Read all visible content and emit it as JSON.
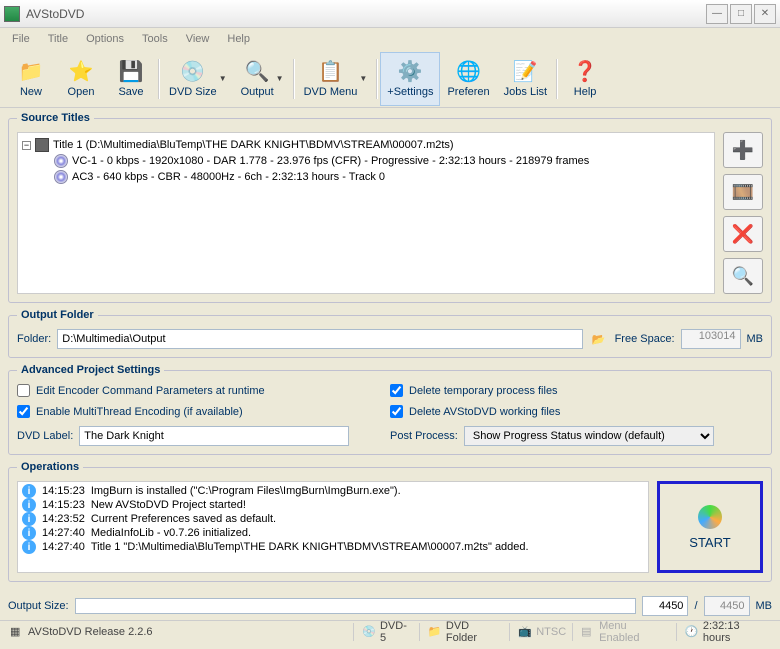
{
  "window": {
    "title": "AVStoDVD"
  },
  "menu": [
    "File",
    "Title",
    "Options",
    "Tools",
    "View",
    "Help"
  ],
  "toolbar": [
    {
      "id": "new",
      "label": "New",
      "icon": "📁"
    },
    {
      "id": "open",
      "label": "Open",
      "icon": "⭐"
    },
    {
      "id": "save",
      "label": "Save",
      "icon": "💾"
    },
    {
      "id": "dvdsize",
      "label": "DVD Size",
      "icon": "💿",
      "dd": true
    },
    {
      "id": "output",
      "label": "Output",
      "icon": "🔍",
      "dd": true
    },
    {
      "id": "dvdmenu",
      "label": "DVD Menu",
      "icon": "📋",
      "dd": true
    },
    {
      "id": "settings",
      "label": "+Settings",
      "icon": "⚙️",
      "sel": true
    },
    {
      "id": "preferen",
      "label": "Preferen",
      "icon": "🌐"
    },
    {
      "id": "jobslist",
      "label": "Jobs List",
      "icon": "📝"
    },
    {
      "id": "help",
      "label": "Help",
      "icon": "❓"
    }
  ],
  "groups": {
    "source": "Source Titles",
    "output": "Output Folder",
    "advanced": "Advanced Project Settings",
    "operations": "Operations"
  },
  "source": {
    "root": "Title 1 (D:\\Multimedia\\BluTemp\\THE DARK KNIGHT\\BDMV\\STREAM\\00007.m2ts)",
    "children": [
      "VC-1 - 0 kbps - 1920x1080 - DAR 1.778 - 23.976 fps (CFR) - Progressive - 2:32:13 hours - 218979 frames",
      "AC3 - 640 kbps - CBR - 48000Hz - 6ch - 2:32:13 hours - Track 0"
    ]
  },
  "output": {
    "folder_label": "Folder:",
    "folder": "D:\\Multimedia\\Output",
    "freespace_label": "Free Space:",
    "freespace": "103014",
    "mb": "MB"
  },
  "advanced": {
    "edit_cmd": "Edit Encoder Command Parameters at runtime",
    "multithread": "Enable MultiThread Encoding (if available)",
    "del_temp": "Delete temporary process files",
    "del_work": "Delete AVStoDVD working files",
    "dvd_label_label": "DVD Label:",
    "dvd_label": "The Dark Knight",
    "postprocess_label": "Post Process:",
    "postprocess": "Show Progress Status window (default)"
  },
  "operations": {
    "log": [
      {
        "t": "14:15:23",
        "m": "ImgBurn is installed (\"C:\\Program Files\\ImgBurn\\ImgBurn.exe\")."
      },
      {
        "t": "14:15:23",
        "m": "New AVStoDVD Project started!"
      },
      {
        "t": "14:23:52",
        "m": "Current Preferences saved as default."
      },
      {
        "t": "14:27:40",
        "m": "MediaInfoLib - v0.7.26 initialized."
      },
      {
        "t": "14:27:40",
        "m": "Title 1 \"D:\\Multimedia\\BluTemp\\THE DARK KNIGHT\\BDMV\\STREAM\\00007.m2ts\" added."
      }
    ],
    "start": "START"
  },
  "outputsize": {
    "label": "Output Size:",
    "val": "4450",
    "max": "4450",
    "mb": "MB"
  },
  "status": {
    "release": "AVStoDVD Release 2.2.6",
    "dvd": "DVD-5",
    "folder": "DVD Folder",
    "ntsc": "NTSC",
    "menu": "Menu Enabled",
    "duration": "2:32:13 hours"
  }
}
